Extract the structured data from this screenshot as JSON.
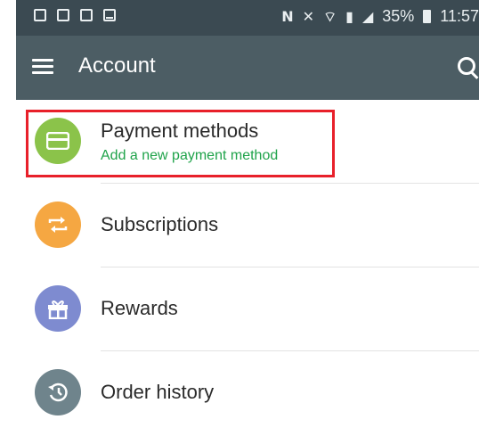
{
  "statusbar": {
    "battery_text": "35%",
    "time": "11:57",
    "icons": [
      "image-icon",
      "phone-icon",
      "photo-icon",
      "mail-icon",
      "nfc-icon",
      "mute-icon",
      "wifi-icon",
      "sim-icon",
      "signal-icon",
      "battery-icon"
    ]
  },
  "appbar": {
    "title": "Account",
    "menu_icon": "hamburger-menu-icon",
    "search_icon": "search-icon"
  },
  "list": {
    "items": [
      {
        "label": "Payment methods",
        "sublabel": "Add a new payment method",
        "icon": "credit-card-icon",
        "color": "#8bc34a"
      },
      {
        "label": "Subscriptions",
        "icon": "repeat-icon",
        "color": "#f5a742"
      },
      {
        "label": "Rewards",
        "icon": "gift-icon",
        "color": "#7e8bd0"
      },
      {
        "label": "Order history",
        "icon": "history-icon",
        "color": "#6f848c"
      }
    ]
  },
  "colors": {
    "statusbar": "#3b4a52",
    "appbar": "#4c5d64",
    "highlight": "#e8202a",
    "sublabel": "#1fa34a"
  }
}
